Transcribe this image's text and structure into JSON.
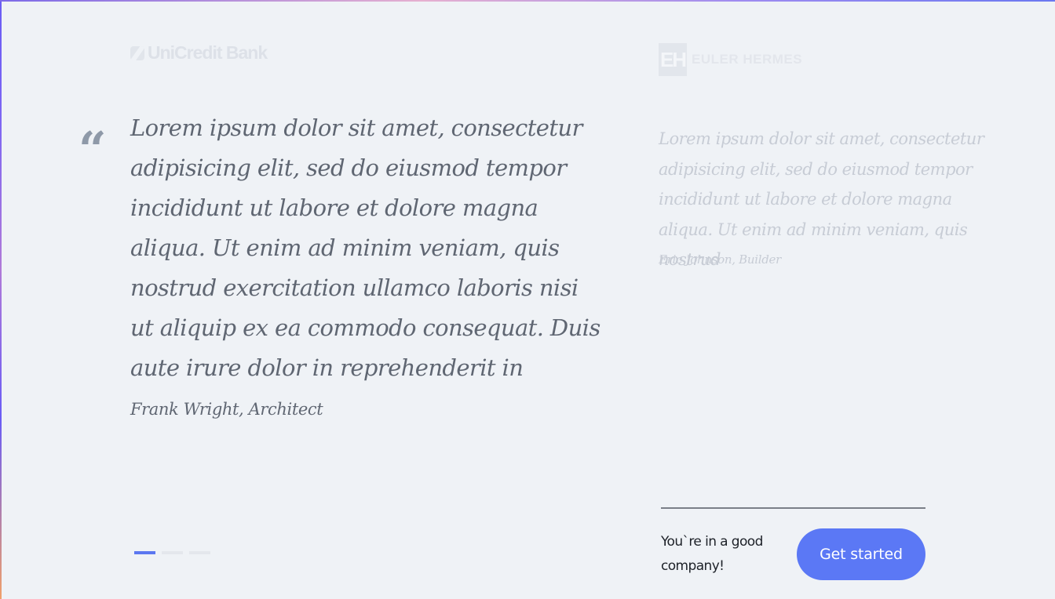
{
  "logos": {
    "left": {
      "text": "UniCredit Bank",
      "icon": "unicredit-logo-mark"
    },
    "right": {
      "mark": "EH",
      "text": "EULER HERMES"
    }
  },
  "testimonials": [
    {
      "quote": "Lorem ipsum dolor sit amet, consectetur adipisicing elit, sed do eiusmod tempor incididunt ut labore et dolore magna aliqua. Ut enim ad minim veniam, quis nostrud exercitation ullamco laboris nisi ut aliquip ex ea commodo consequat. Duis aute irure dolor in reprehenderit in",
      "author": "Frank Wright, Architect"
    },
    {
      "quote": "Lorem ipsum dolor sit amet, consectetur adipisicing elit, sed do eiusmod tempor incididunt ut labore et dolore magna aliqua. Ut enim ad minim veniam, quis nostrud",
      "author": "Eric Johnson, Builder"
    }
  ],
  "quote_icon": {
    "glyph": "“",
    "icon": "quote-icon"
  },
  "pager": {
    "count": 3,
    "active": 1
  },
  "cta": {
    "text": "You`re in a good company!",
    "button_label": "Get started"
  },
  "colors": {
    "accent": "#5b78f5",
    "background": "#eff2f6",
    "text_main": "#5f6672",
    "text_faded": "#c7ccd5"
  }
}
